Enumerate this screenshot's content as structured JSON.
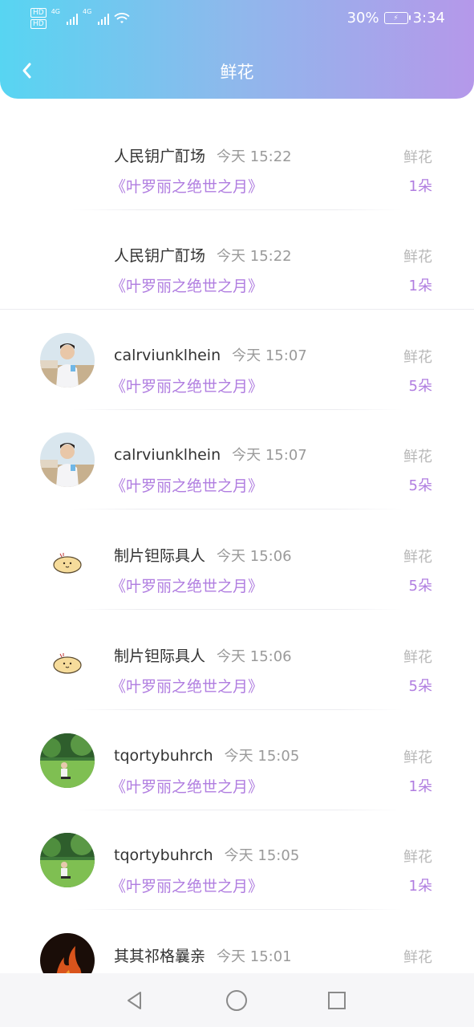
{
  "status_bar": {
    "battery_percent": "30%",
    "time": "3:34",
    "hd_labels": [
      "HD",
      "HD"
    ],
    "network_labels": [
      "4G",
      "4G"
    ]
  },
  "header": {
    "title": "鲜花",
    "back_icon": "chevron-left-icon"
  },
  "colors": {
    "gradient_start": "#57d5f2",
    "gradient_end": "#b598ea",
    "accent_purple": "#b07de0"
  },
  "records": [
    {
      "name": "人民钥广酊场",
      "time": "今天 15:22",
      "book": "《叶罗丽之绝世之月》",
      "gift": "鲜花",
      "count": "1朵",
      "avatar": "none"
    },
    {
      "name": "人民钥广酊场",
      "time": "今天 15:22",
      "book": "《叶罗丽之绝世之月》",
      "gift": "鲜花",
      "count": "1朵",
      "avatar": "none"
    },
    {
      "name": "calrviunklhein",
      "time": "今天 15:07",
      "book": "《叶罗丽之绝世之月》",
      "gift": "鲜花",
      "count": "5朵",
      "avatar": "person-photo"
    },
    {
      "name": "calrviunklhein",
      "time": "今天 15:07",
      "book": "《叶罗丽之绝世之月》",
      "gift": "鲜花",
      "count": "5朵",
      "avatar": "person-photo"
    },
    {
      "name": "制片钽际具人",
      "time": "今天 15:06",
      "book": "《叶罗丽之绝世之月》",
      "gift": "鲜花",
      "count": "5朵",
      "avatar": "cartoon-bun"
    },
    {
      "name": "制片钽际具人",
      "time": "今天 15:06",
      "book": "《叶罗丽之绝世之月》",
      "gift": "鲜花",
      "count": "5朵",
      "avatar": "cartoon-bun"
    },
    {
      "name": "tqortybuhrch",
      "time": "今天 15:05",
      "book": "《叶罗丽之绝世之月》",
      "gift": "鲜花",
      "count": "1朵",
      "avatar": "lawn-photo"
    },
    {
      "name": "tqortybuhrch",
      "time": "今天 15:05",
      "book": "《叶罗丽之绝世之月》",
      "gift": "鲜花",
      "count": "1朵",
      "avatar": "lawn-photo"
    },
    {
      "name": "其其祁格曩亲",
      "time": "今天 15:01",
      "book": "",
      "gift": "鲜花",
      "count": "",
      "avatar": "fire-photo"
    }
  ],
  "system_nav": {
    "back": "triangle-back-icon",
    "home": "circle-home-icon",
    "recents": "square-recents-icon"
  }
}
